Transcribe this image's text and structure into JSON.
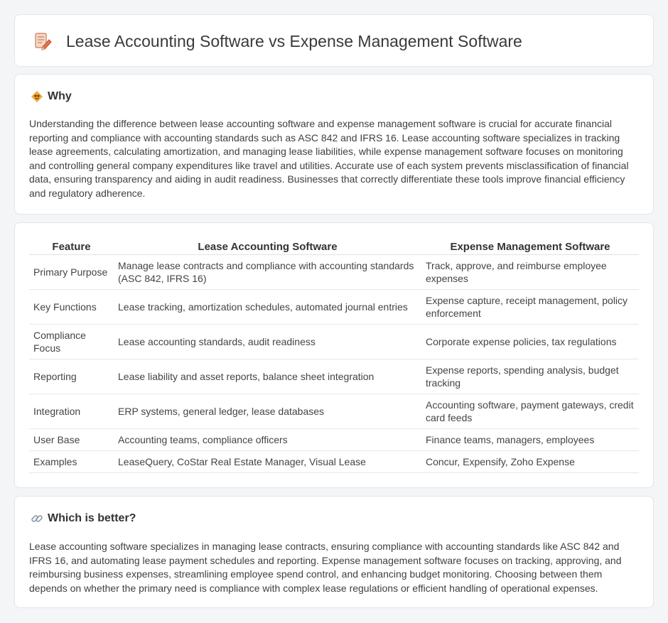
{
  "header": {
    "title": "Lease Accounting Software vs Expense Management Software",
    "icon": "document-pencil-icon"
  },
  "why": {
    "title": "Why",
    "icon": "bulb-icon",
    "text": "Understanding the difference between lease accounting software and expense management software is crucial for accurate financial reporting and compliance with accounting standards such as ASC 842 and IFRS 16. Lease accounting software specializes in tracking lease agreements, calculating amortization, and managing lease liabilities, while expense management software focuses on monitoring and controlling general company expenditures like travel and utilities. Accurate use of each system prevents misclassification of financial data, ensuring transparency and aiding in audit readiness. Businesses that correctly differentiate these tools improve financial efficiency and regulatory adherence."
  },
  "comparison": {
    "headers": [
      "Feature",
      "Lease Accounting Software",
      "Expense Management Software"
    ],
    "rows": [
      [
        "Primary Purpose",
        "Manage lease contracts and compliance with accounting standards (ASC 842, IFRS 16)",
        "Track, approve, and reimburse employee expenses"
      ],
      [
        "Key Functions",
        "Lease tracking, amortization schedules, automated journal entries",
        "Expense capture, receipt management, policy enforcement"
      ],
      [
        "Compliance Focus",
        "Lease accounting standards, audit readiness",
        "Corporate expense policies, tax regulations"
      ],
      [
        "Reporting",
        "Lease liability and asset reports, balance sheet integration",
        "Expense reports, spending analysis, budget tracking"
      ],
      [
        "Integration",
        "ERP systems, general ledger, lease databases",
        "Accounting software, payment gateways, credit card feeds"
      ],
      [
        "User Base",
        "Accounting teams, compliance officers",
        "Finance teams, managers, employees"
      ],
      [
        "Examples",
        "LeaseQuery, CoStar Real Estate Manager, Visual Lease",
        "Concur, Expensify, Zoho Expense"
      ]
    ]
  },
  "better": {
    "title": "Which is better?",
    "icon": "link-icon",
    "text": "Lease accounting software specializes in managing lease contracts, ensuring compliance with accounting standards like ASC 842 and IFRS 16, and automating lease payment schedules and reporting. Expense management software focuses on tracking, approving, and reimbursing business expenses, streamlining employee spend control, and enhancing budget monitoring. Choosing between them depends on whether the primary need is compliance with complex lease regulations or efficient handling of operational expenses."
  }
}
